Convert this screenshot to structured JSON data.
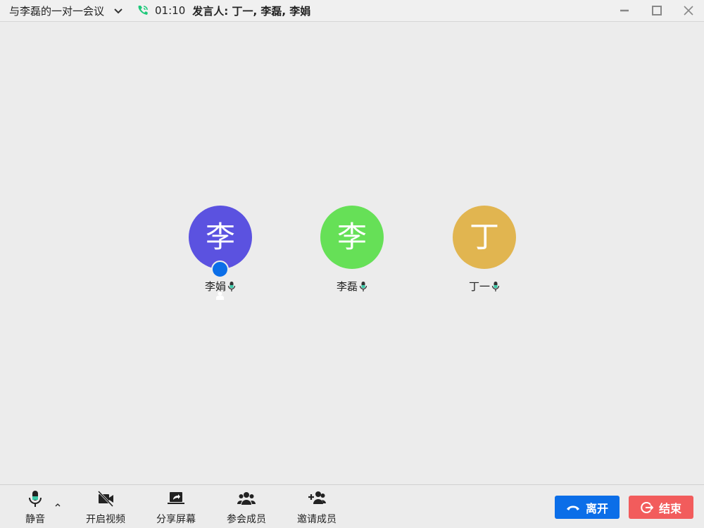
{
  "titlebar": {
    "title": "与李磊的一对一会议",
    "timer": "01:10",
    "speakers": "发言人: 丁一, 李磊, 李娟"
  },
  "participants": [
    {
      "initial": "李",
      "name": "李娟",
      "color": "#5b52e0",
      "host": true
    },
    {
      "initial": "李",
      "name": "李磊",
      "color": "#66e057",
      "host": false
    },
    {
      "initial": "丁",
      "name": "丁一",
      "color": "#e1b550",
      "host": false
    }
  ],
  "toolbar": {
    "mute": "静音",
    "video": "开启视频",
    "share": "分享屏幕",
    "members": "参会成员",
    "invite": "邀请成员",
    "leave": "离开",
    "end": "结束"
  },
  "colors": {
    "leave": "#0b6ee8",
    "end": "#f25c5c",
    "call": "#1ec87a"
  }
}
